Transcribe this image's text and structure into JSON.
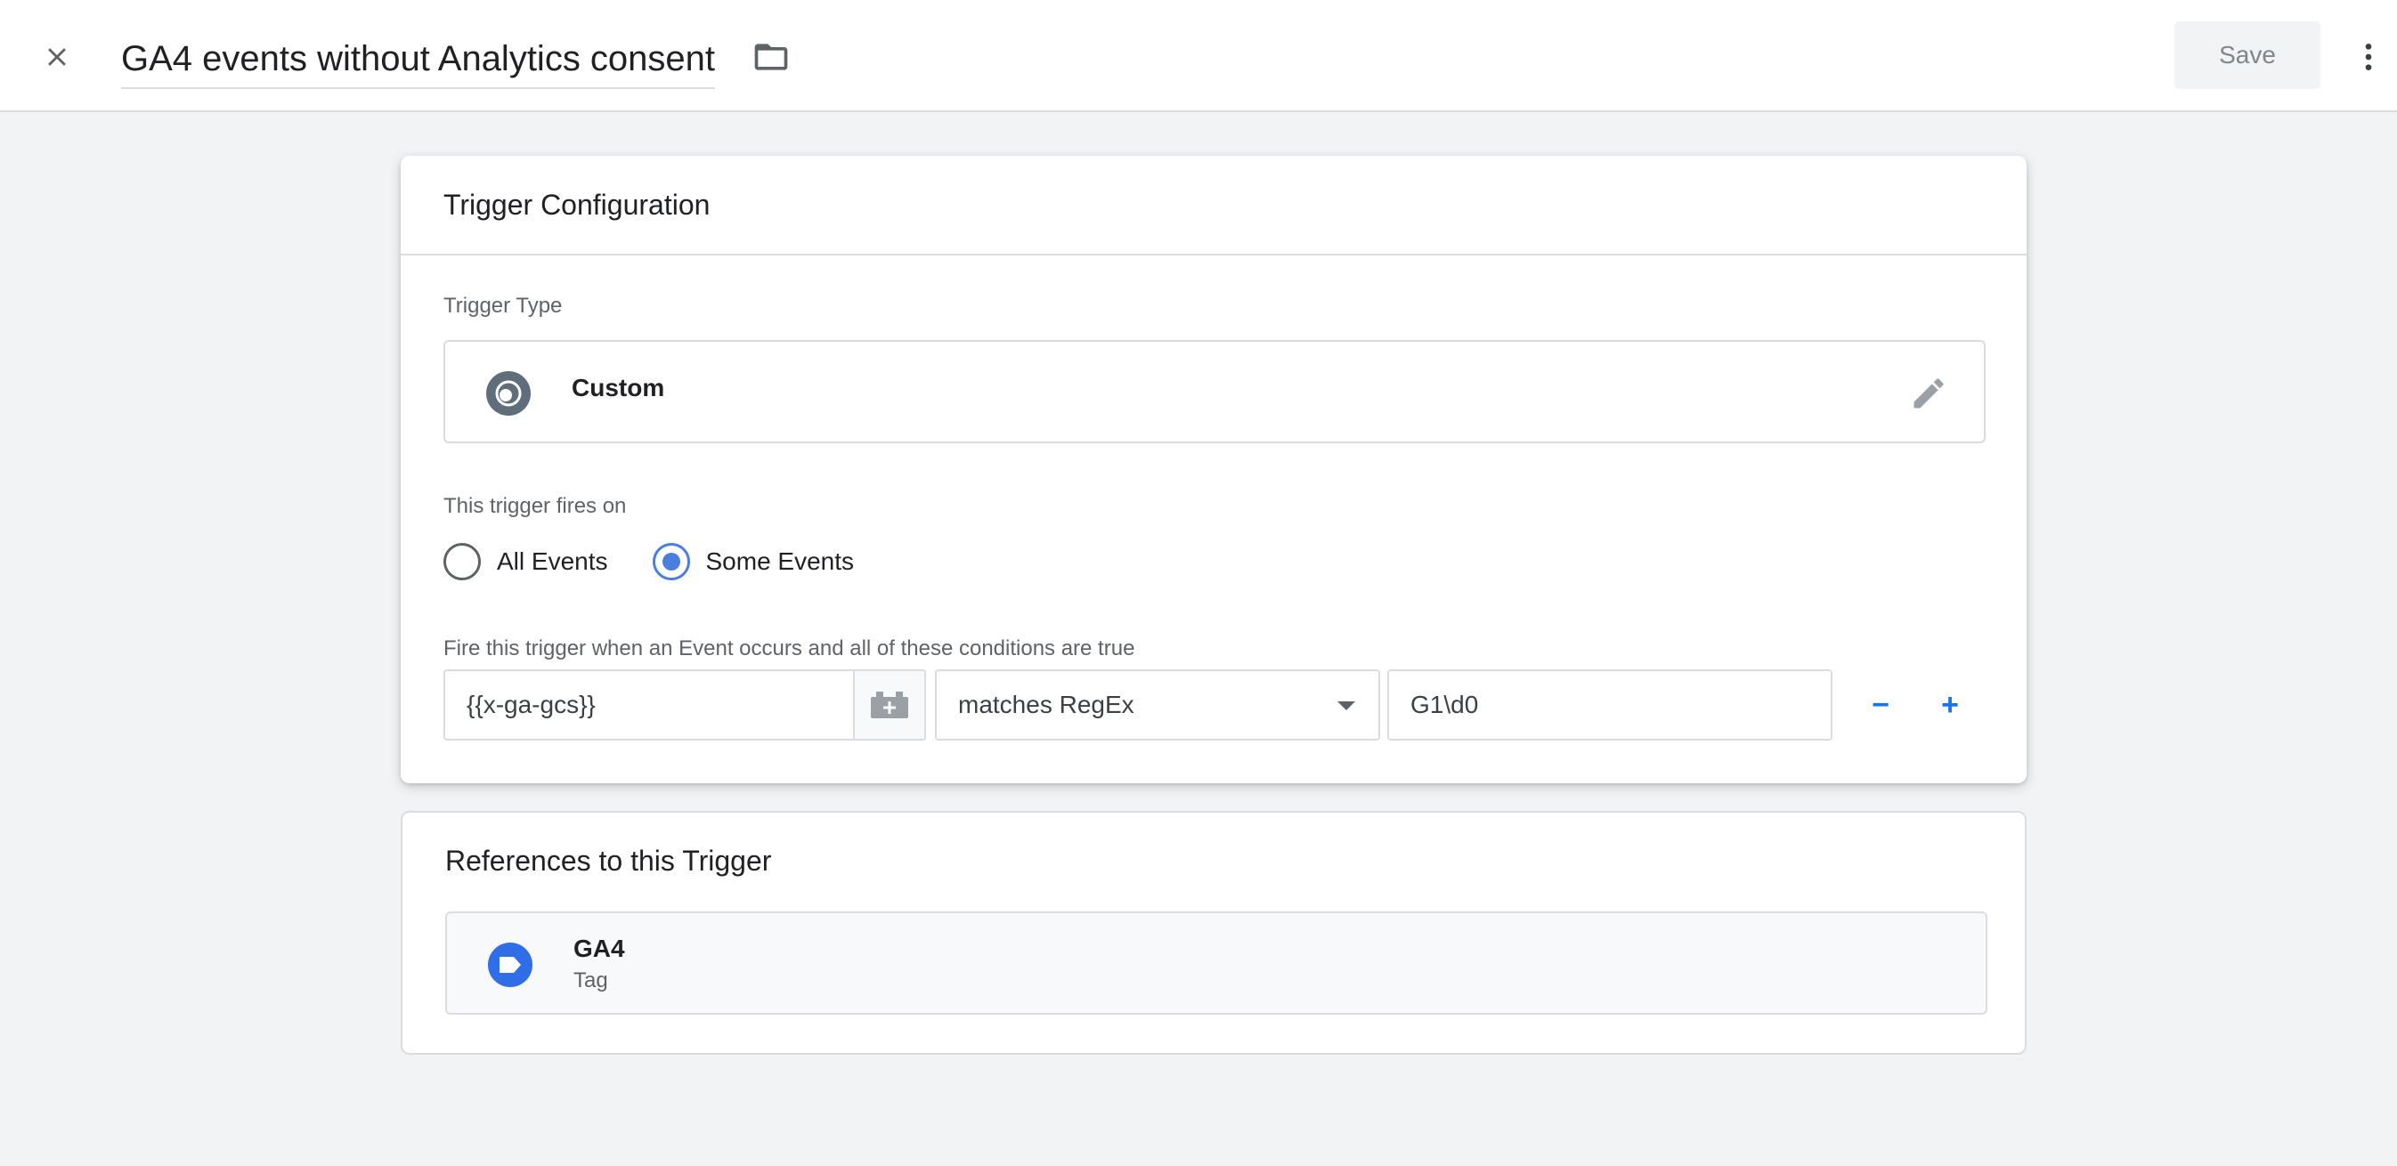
{
  "header": {
    "trigger_name": "GA4 events without Analytics consent",
    "save_label": "Save"
  },
  "config_card": {
    "title": "Trigger Configuration",
    "trigger_type_label": "Trigger Type",
    "trigger_type_value": "Custom",
    "fires_on_label": "This trigger fires on",
    "radio_options": [
      {
        "label": "All Events",
        "checked": false
      },
      {
        "label": "Some Events",
        "checked": true
      }
    ],
    "condition_label": "Fire this trigger when an Event occurs and all of these conditions are true",
    "condition": {
      "variable": "{{x-ga-gcs}}",
      "operator": "matches RegEx",
      "value": "G1\\d0"
    },
    "minus_label": "−",
    "plus_label": "+"
  },
  "refs_card": {
    "title": "References to this Trigger",
    "items": [
      {
        "name": "GA4",
        "kind": "Tag"
      }
    ]
  },
  "icons": {
    "close": "close-icon",
    "folder": "folder-icon",
    "more": "more-vert-icon",
    "trigger_type": "custom-event-icon",
    "edit": "pencil-icon",
    "variable_picker": "add-variable-icon",
    "tag": "tag-icon"
  },
  "colors": {
    "accent": "#1a73e8",
    "radio_checked": "#4a7fe0",
    "tag_icon": "#2f6ee6",
    "custom_icon": "#5f6e7a"
  }
}
